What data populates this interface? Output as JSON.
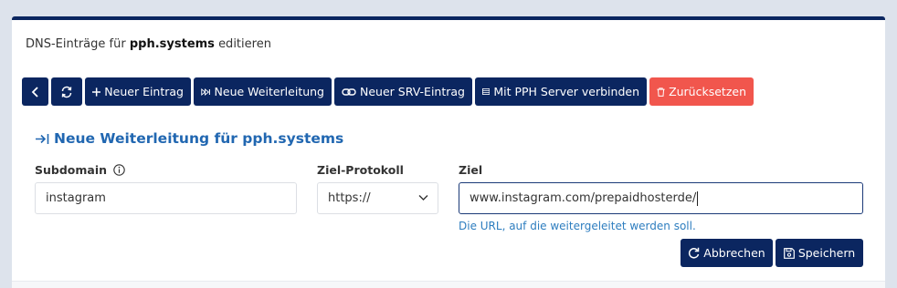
{
  "header": {
    "prefix": "DNS-Einträge für",
    "domain": "pph.systems",
    "suffix": "editieren"
  },
  "toolbar": {
    "new_entry": "Neuer Eintrag",
    "new_redirect": "Neue Weiterleitung",
    "new_srv": "Neuer SRV-Eintrag",
    "connect_server": "Mit PPH Server verbinden",
    "reset": "Zurücksetzen"
  },
  "form": {
    "title": "Neue Weiterleitung für pph.systems",
    "subdomain_label": "Subdomain",
    "subdomain_value": "instagram",
    "protocol_label": "Ziel-Protokoll",
    "protocol_value": "https://",
    "target_label": "Ziel",
    "target_value": "www.instagram.com/prepaidhosterde/",
    "target_hint": "Die URL, auf die weitergeleitet werden soll.",
    "cancel": "Abbrechen",
    "save": "Speichern"
  },
  "colors": {
    "primary": "#0b2660",
    "danger": "#f1564d",
    "accent": "#2167b1",
    "hint": "#2d7dbf"
  }
}
